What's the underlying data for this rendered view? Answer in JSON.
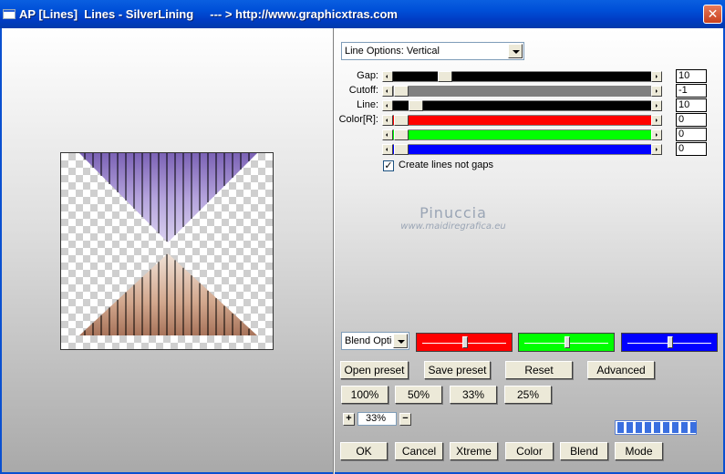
{
  "window": {
    "title": "AP [Lines]  Lines - SilverLining     --- > http://www.graphicxtras.com",
    "close_symbol": "✕"
  },
  "line_options": {
    "selected": "Line Options: Vertical"
  },
  "sliders": [
    {
      "label": "Gap:",
      "value": "10",
      "fill": "#000000",
      "level": 0.18
    },
    {
      "label": "Cutoff:",
      "value": "-1",
      "fill": "#808080",
      "level": 0.0
    },
    {
      "label": "Line:",
      "value": "10",
      "fill": "#000000",
      "level": 0.06
    },
    {
      "label": "Color[R]:",
      "value": "0",
      "fill": "#ff0000",
      "level": 0.0
    },
    {
      "label": "",
      "value": "0",
      "fill": "#00ff00",
      "level": 0.0
    },
    {
      "label": "",
      "value": "0",
      "fill": "#0000ff",
      "level": 0.0
    }
  ],
  "checkbox": {
    "label": "Create lines not gaps",
    "checked": true,
    "mark": "✓"
  },
  "watermark": {
    "name": "Pinuccia",
    "url": "www.maidiregrafica.eu"
  },
  "blend_options": {
    "selected": "Blend Optio"
  },
  "blend_swatches": [
    {
      "color": "#ff0000",
      "level": 0.5
    },
    {
      "color": "#00ff00",
      "level": 0.5
    },
    {
      "color": "#0000ff",
      "level": 0.5
    }
  ],
  "buttons": {
    "open_preset": "Open preset",
    "save_preset": "Save preset",
    "reset": "Reset",
    "advanced": "Advanced",
    "zoom_100": "100%",
    "zoom_50": "50%",
    "zoom_33": "33%",
    "zoom_25": "25%",
    "ok": "OK",
    "cancel": "Cancel",
    "xtreme": "Xtreme",
    "color": "Color",
    "blend": "Blend",
    "mode": "Mode"
  },
  "zoom": {
    "plus": "+",
    "minus": "−",
    "value": "33%"
  },
  "progress": {
    "segments_filled": 9,
    "segments_total": 9
  },
  "colors": {
    "titlebar": "#0050d8",
    "top_gem": "#9a85c8",
    "bottom_gem": "#c9957a"
  }
}
